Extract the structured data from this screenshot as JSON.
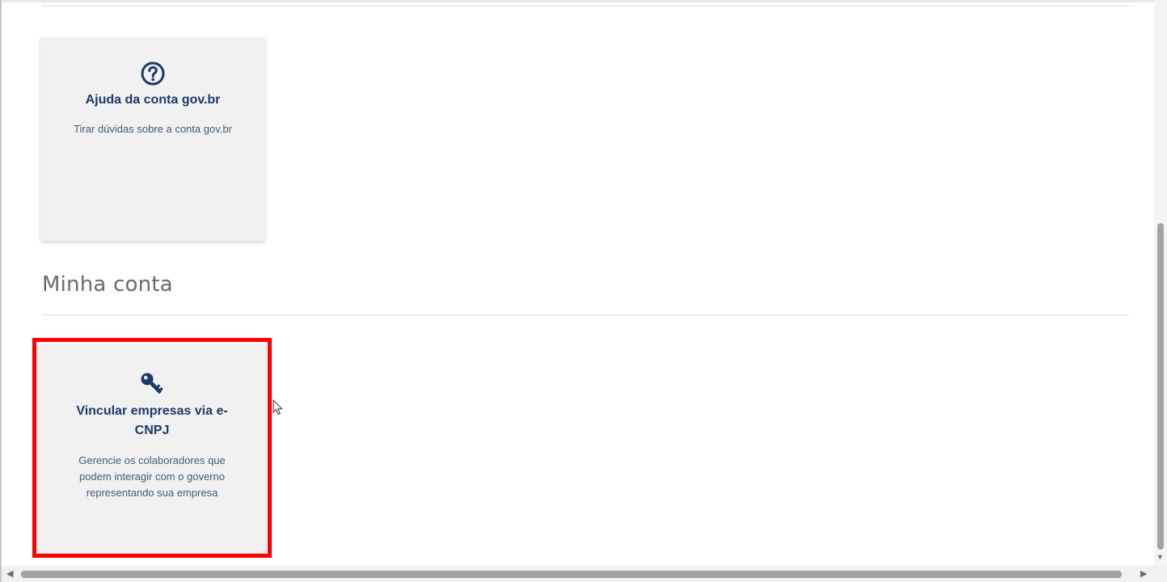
{
  "cards": {
    "help": {
      "icon": "question-circle-icon",
      "title": "Ajuda da conta gov.br",
      "description": "Tirar dúvidas sobre a conta gov.br"
    },
    "ecnpj": {
      "icon": "key-icon",
      "title_line1": "Vincular empresas via e-",
      "title_line2": "CNPJ",
      "desc_line1": "Gerencie os colaboradores que",
      "desc_line2": "podem interagir com o governo",
      "desc_line3": "representando sua empresa"
    }
  },
  "section": {
    "title": "Minha conta"
  },
  "colors": {
    "brand_navy": "#1b3a6b",
    "card_bg": "#f0f1f0",
    "highlight": "#ff0000"
  }
}
